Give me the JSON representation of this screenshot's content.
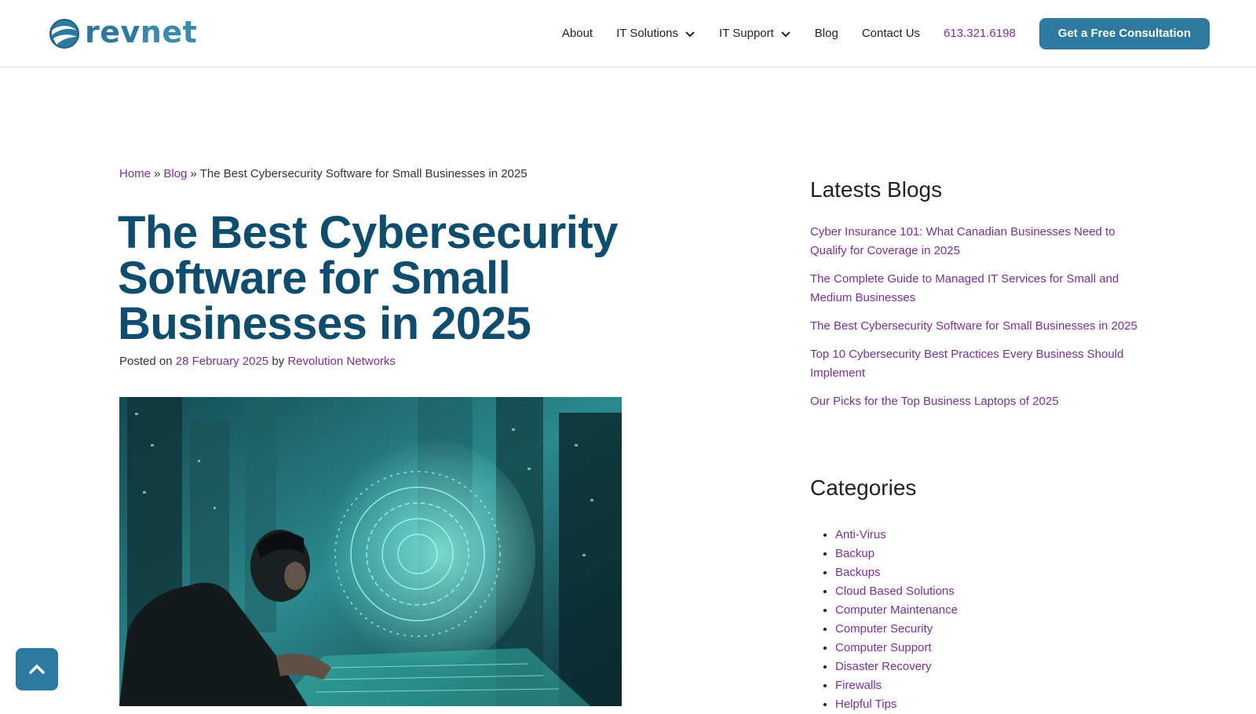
{
  "brand": {
    "logo_icon": "revnet-logo-icon",
    "logo_part1": "rev",
    "logo_part2": "net",
    "primary_color": "#2d7aa0",
    "link_color": "#7a2f9a",
    "title_color": "#0e4d6e"
  },
  "nav": {
    "about": "About",
    "it_solutions": "IT Solutions",
    "it_support": "IT Support",
    "blog": "Blog",
    "contact": "Contact Us",
    "phone": "613.321.6198",
    "cta": "Get a Free Consultation"
  },
  "breadcrumb": {
    "home": "Home",
    "sep": "»",
    "blog": "Blog",
    "current": "The Best Cybersecurity Software for Small Businesses in 2025"
  },
  "article": {
    "title": "The Best Cybersecurity Software for Small Businesses in 2025",
    "posted_on": "Posted on",
    "date": "28 February 2025",
    "by": "by",
    "author": "Revolution Networks",
    "image_alt": "man-at-holographic-computer-image"
  },
  "sidebar": {
    "latest_heading": "Latests Blogs",
    "latest": [
      "Cyber Insurance 101: What Canadian Businesses Need to Qualify for Coverage in 2025",
      "The Complete Guide to Managed IT Services for Small and Medium Businesses",
      "The Best Cybersecurity Software for Small Businesses in 2025",
      "Top 10 Cybersecurity Best Practices Every Business Should Implement",
      "Our Picks for the Top Business Laptops of 2025"
    ],
    "categories_heading": "Categories",
    "categories": [
      "Anti-Virus",
      "Backup",
      "Backups",
      "Cloud Based Solutions",
      "Computer Maintenance",
      "Computer Security",
      "Computer Support",
      "Disaster Recovery",
      "Firewalls",
      "Helpful Tips"
    ]
  },
  "back_to_top_icon": "chevron-up-icon"
}
